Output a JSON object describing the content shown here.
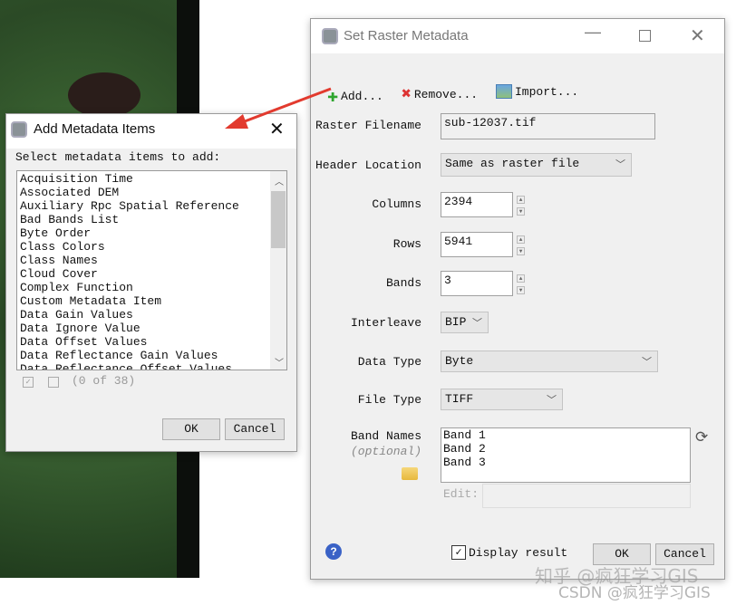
{
  "main_dialog": {
    "title": "Set Raster Metadata",
    "toolbar": {
      "add": "Add...",
      "remove": "Remove...",
      "import": "Import..."
    },
    "fields": {
      "raster_filename_label": "Raster Filename",
      "raster_filename": "sub-12037.tif",
      "header_location_label": "Header Location",
      "header_location": "Same as raster file",
      "columns_label": "Columns",
      "columns": "2394",
      "rows_label": "Rows",
      "rows": "5941",
      "bands_label": "Bands",
      "bands": "3",
      "interleave_label": "Interleave",
      "interleave": "BIP",
      "data_type_label": "Data Type",
      "data_type": "Byte",
      "file_type_label": "File Type",
      "file_type": "TIFF",
      "band_names_label": "Band Names",
      "band_names_optional": "(optional)",
      "band_names": [
        "Band 1",
        "Band 2",
        "Band 3"
      ],
      "edit_label": "Edit:"
    },
    "display_result_label": "Display result",
    "display_result_checked": true,
    "ok": "OK",
    "cancel": "Cancel"
  },
  "add_dialog": {
    "title": "Add Metadata Items",
    "prompt": "Select metadata items to add:",
    "items": [
      "Acquisition Time",
      "Associated DEM",
      "Auxiliary Rpc Spatial Reference",
      "Bad Bands List",
      "Byte Order",
      "Class Colors",
      "Class Names",
      "Cloud Cover",
      "Complex Function",
      "Custom Metadata Item",
      "Data Gain Values",
      "Data Ignore Value",
      "Data Offset Values",
      "Data Reflectance Gain Values",
      "Data Reflectance Offset Values"
    ],
    "count": "(0 of 38)",
    "ok": "OK",
    "cancel": "Cancel"
  },
  "watermark": {
    "line1": "知乎 @疯狂学习GIS",
    "line2": "CSDN @疯狂学习GIS"
  }
}
